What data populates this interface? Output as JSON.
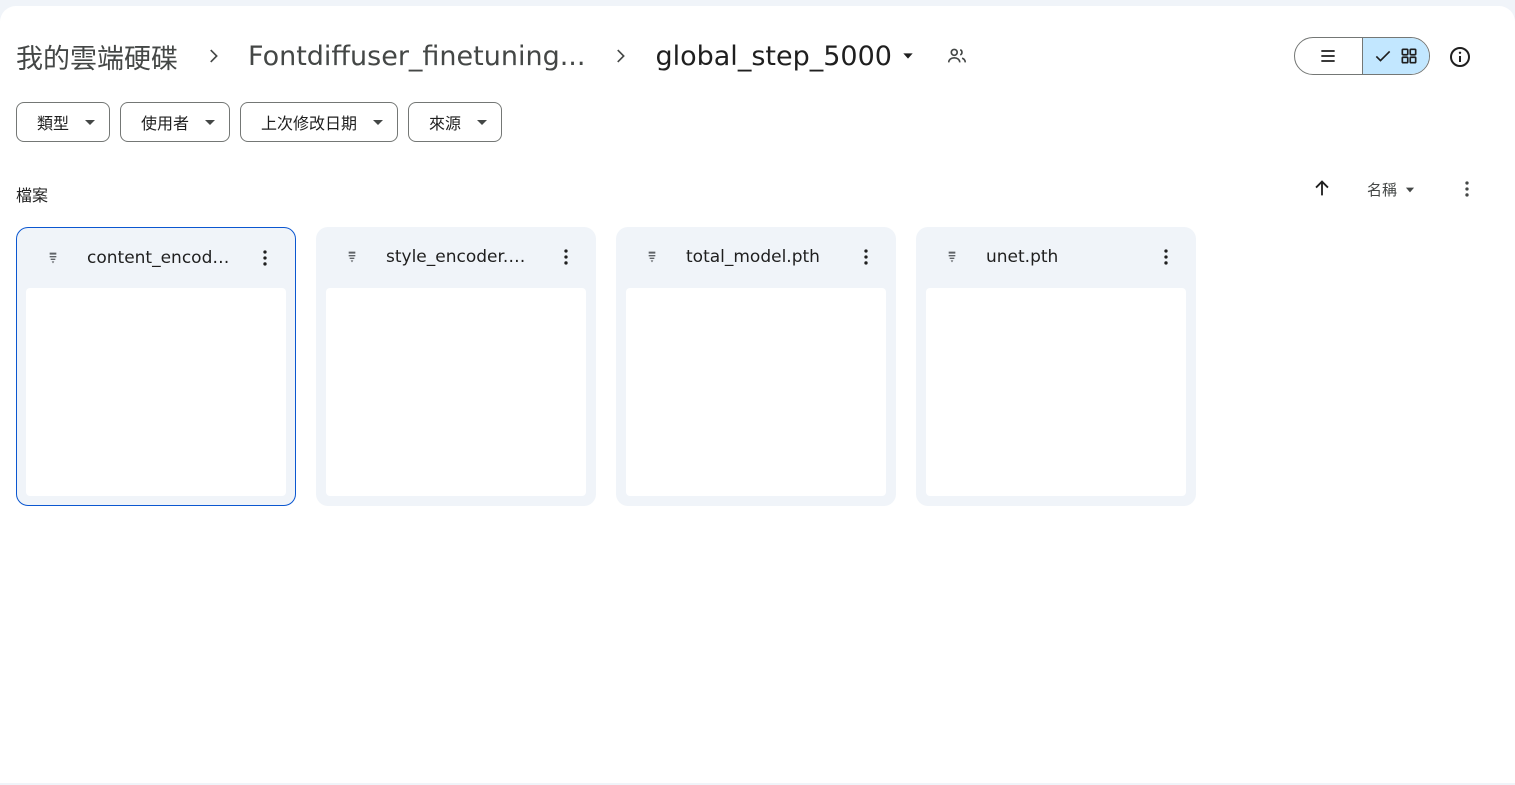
{
  "breadcrumb": {
    "root": "我的雲端硬碟",
    "parent": "Fontdiffuser_finetuning...",
    "current": "global_step_5000"
  },
  "filters": [
    {
      "label": "類型"
    },
    {
      "label": "使用者"
    },
    {
      "label": "上次修改日期"
    },
    {
      "label": "來源"
    }
  ],
  "section": {
    "title": "檔案",
    "sort_label": "名稱"
  },
  "files": [
    {
      "name": "content_encoder.pth",
      "selected": true
    },
    {
      "name": "style_encoder.pth",
      "selected": false
    },
    {
      "name": "total_model.pth",
      "selected": false
    },
    {
      "name": "unet.pth",
      "selected": false
    }
  ],
  "icons": {
    "file": "binary-file-icon",
    "more": "more-vert-icon",
    "list_view": "list-view-icon",
    "grid_view": "grid-view-icon",
    "info": "info-icon",
    "shared": "shared-folder-icon",
    "sort": "arrow-upward-icon"
  },
  "colors": {
    "accent": "#0b57d0",
    "toggle_active": "#c2e7ff",
    "card_bg": "#f0f4f9"
  }
}
